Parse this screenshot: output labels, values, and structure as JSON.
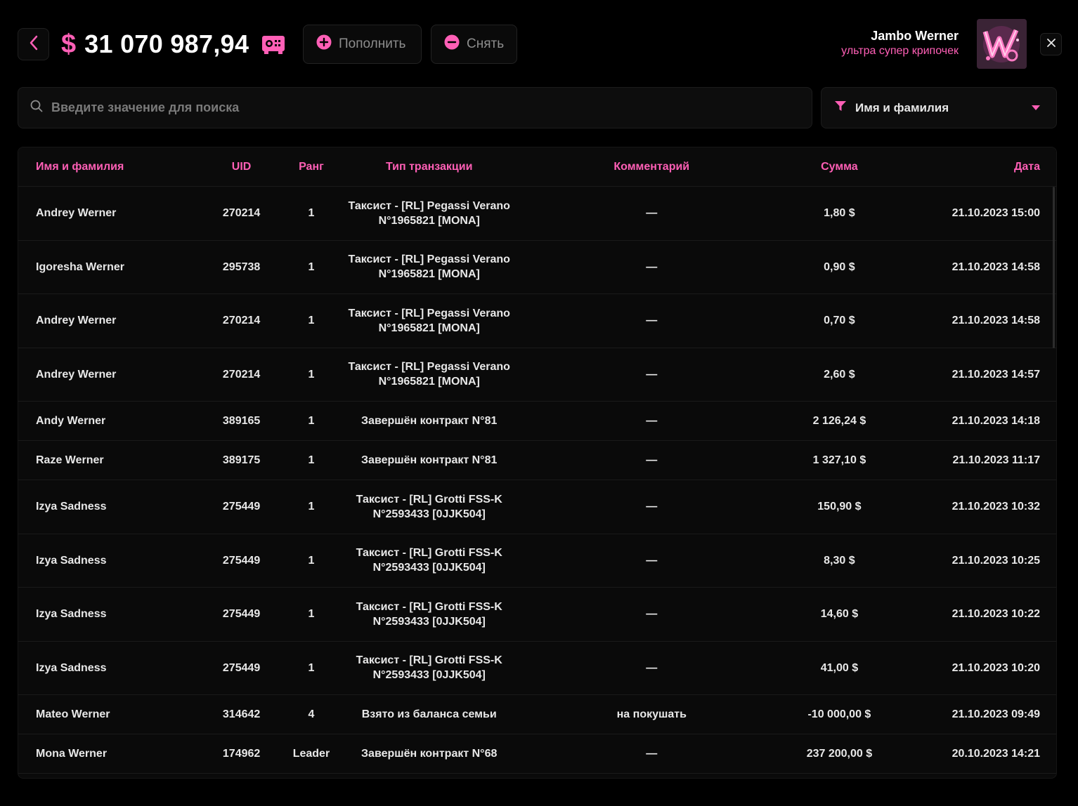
{
  "header": {
    "currency_symbol": "$",
    "balance": "31 070 987,94",
    "deposit_label": "Пополнить",
    "withdraw_label": "Снять",
    "user_name": "Jambo Werner",
    "user_status": "ультра супер крипочек"
  },
  "search": {
    "placeholder": "Введите значение для поиска"
  },
  "filter": {
    "selected": "Имя и фамилия"
  },
  "colors": {
    "accent": "#ff5fb6",
    "background": "#000000",
    "panel": "#0a0a0a"
  },
  "icons": [
    "chevron-left-icon",
    "safe-icon",
    "plus-circle-icon",
    "minus-circle-icon",
    "close-icon",
    "search-icon",
    "filter-icon",
    "caret-down-icon"
  ],
  "table": {
    "columns": [
      "Имя и фамилия",
      "UID",
      "Ранг",
      "Тип транзакции",
      "Комментарий",
      "Сумма",
      "Дата"
    ],
    "rows": [
      {
        "name": "Andrey Werner",
        "uid": "270214",
        "rank": "1",
        "type_line1": "Таксист - [RL] Pegassi Verano",
        "type_line2": "N°1965821 [MONA]",
        "comment": "—",
        "sum": "1,80 $",
        "date": "21.10.2023 15:00"
      },
      {
        "name": "Igoresha Werner",
        "uid": "295738",
        "rank": "1",
        "type_line1": "Таксист - [RL] Pegassi Verano",
        "type_line2": "N°1965821 [MONA]",
        "comment": "—",
        "sum": "0,90 $",
        "date": "21.10.2023 14:58"
      },
      {
        "name": "Andrey Werner",
        "uid": "270214",
        "rank": "1",
        "type_line1": "Таксист - [RL] Pegassi Verano",
        "type_line2": "N°1965821 [MONA]",
        "comment": "—",
        "sum": "0,70 $",
        "date": "21.10.2023 14:58"
      },
      {
        "name": "Andrey Werner",
        "uid": "270214",
        "rank": "1",
        "type_line1": "Таксист - [RL] Pegassi Verano",
        "type_line2": "N°1965821 [MONA]",
        "comment": "—",
        "sum": "2,60 $",
        "date": "21.10.2023 14:57"
      },
      {
        "name": "Andy Werner",
        "uid": "389165",
        "rank": "1",
        "type_line1": "Завершён контракт N°81",
        "type_line2": "",
        "comment": "—",
        "sum": "2 126,24 $",
        "date": "21.10.2023 14:18"
      },
      {
        "name": "Raze Werner",
        "uid": "389175",
        "rank": "1",
        "type_line1": "Завершён контракт N°81",
        "type_line2": "",
        "comment": "—",
        "sum": "1 327,10 $",
        "date": "21.10.2023 11:17"
      },
      {
        "name": "Izya Sadness",
        "uid": "275449",
        "rank": "1",
        "type_line1": "Таксист - [RL] Grotti FSS-K",
        "type_line2": "N°2593433 [0JJK504]",
        "comment": "—",
        "sum": "150,90 $",
        "date": "21.10.2023 10:32"
      },
      {
        "name": "Izya Sadness",
        "uid": "275449",
        "rank": "1",
        "type_line1": "Таксист - [RL] Grotti FSS-K",
        "type_line2": "N°2593433 [0JJK504]",
        "comment": "—",
        "sum": "8,30 $",
        "date": "21.10.2023 10:25"
      },
      {
        "name": "Izya Sadness",
        "uid": "275449",
        "rank": "1",
        "type_line1": "Таксист - [RL] Grotti FSS-K",
        "type_line2": "N°2593433 [0JJK504]",
        "comment": "—",
        "sum": "14,60 $",
        "date": "21.10.2023 10:22"
      },
      {
        "name": "Izya Sadness",
        "uid": "275449",
        "rank": "1",
        "type_line1": "Таксист - [RL] Grotti FSS-K",
        "type_line2": "N°2593433 [0JJK504]",
        "comment": "—",
        "sum": "41,00 $",
        "date": "21.10.2023 10:20"
      },
      {
        "name": "Mateo Werner",
        "uid": "314642",
        "rank": "4",
        "type_line1": "Взято из баланса семьи",
        "type_line2": "",
        "comment": "на покушать",
        "sum": "-10 000,00 $",
        "date": "21.10.2023 09:49"
      },
      {
        "name": "Mona Werner",
        "uid": "174962",
        "rank": "Leader",
        "type_line1": "Завершён контракт N°68",
        "type_line2": "",
        "comment": "—",
        "sum": "237 200,00 $",
        "date": "20.10.2023 14:21"
      }
    ]
  }
}
